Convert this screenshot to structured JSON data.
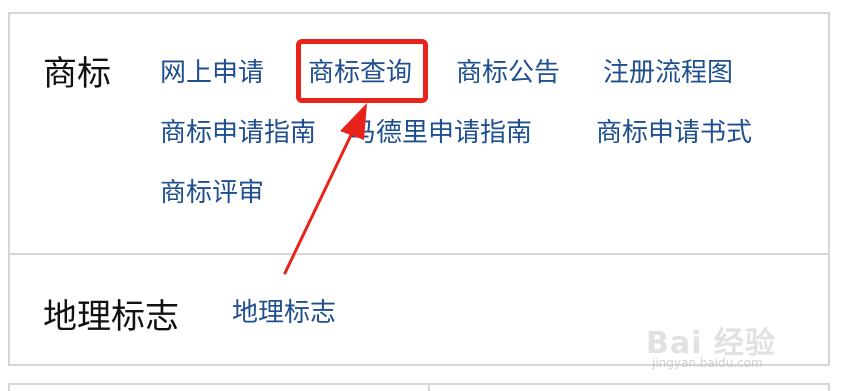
{
  "sections": [
    {
      "title": "商标",
      "links": [
        "网上申请",
        "商标查询",
        "商标公告",
        "注册流程图",
        "商标申请指南",
        "马德里申请指南",
        "商标申请书式",
        "商标评审"
      ]
    },
    {
      "title": "地理标志",
      "links": [
        "地理标志"
      ]
    }
  ],
  "annotation": {
    "highlight_color": "#e8231b",
    "highlighted_link": "商标查询"
  },
  "watermark": {
    "logo": "Bai 经验",
    "url": "jingyan.baidu.com"
  },
  "colors": {
    "link": "#1f4f8f",
    "border": "#d2d7dc",
    "category_text": "#111111"
  }
}
